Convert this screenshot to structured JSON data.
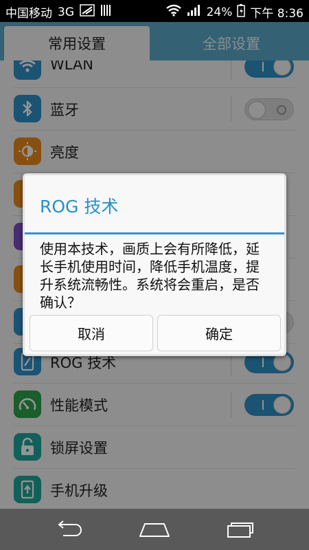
{
  "status_bar": {
    "carrier": "中国移动",
    "network": "3G",
    "battery": "24%",
    "time": "下午 8:36"
  },
  "tabs": [
    {
      "label": "常用设置",
      "selected": true
    },
    {
      "label": "全部设置",
      "selected": false
    }
  ],
  "settings": [
    {
      "label": "WLAN",
      "icon": "wifi-icon",
      "color": "#2f8fc6",
      "toggle": true,
      "on": true
    },
    {
      "label": "蓝牙",
      "icon": "bluetooth-icon",
      "color": "#2f8fc6",
      "toggle": true,
      "on": false
    },
    {
      "label": "亮度",
      "icon": "brightness-icon",
      "color": "#e98a1c",
      "toggle": false
    },
    {
      "label": "",
      "icon": "hidden-item-icon",
      "color": "#e98a1c",
      "toggle": false
    },
    {
      "label": "",
      "icon": "hidden-item-icon",
      "color": "#7c4fbf",
      "toggle": false
    },
    {
      "label": "",
      "icon": "hidden-item-icon",
      "color": "#e98a1c",
      "toggle": false
    },
    {
      "label": "",
      "icon": "hidden-item-icon",
      "color": "#2f8fc6",
      "toggle": true,
      "on": false
    },
    {
      "label": "ROG 技术",
      "icon": "rog-phone-icon",
      "color": "#2f8fc6",
      "toggle": true,
      "on": true
    },
    {
      "label": "性能模式",
      "icon": "speedometer-icon",
      "color": "#2ea24a",
      "toggle": true,
      "on": true
    },
    {
      "label": "锁屏设置",
      "icon": "unlock-icon",
      "color": "#1ea69a",
      "toggle": false
    },
    {
      "label": "手机升级",
      "icon": "phone-upgrade-icon",
      "color": "#1ea69a",
      "toggle": false
    }
  ],
  "dialog": {
    "title": "ROG 技术",
    "message": "使用本技术，画质上会有所降低，延长手机使用时间，降低手机温度，提升系统流畅性。系统将会重启，是否确认？",
    "cancel_label": "取消",
    "confirm_label": "确定"
  },
  "nav_bar": {
    "icons": [
      "back-icon",
      "home-icon",
      "recent-apps-icon"
    ]
  },
  "colors": {
    "accent": "#2f95cd",
    "tab_bar": "#5aa9c8",
    "nav_bar": "#595959"
  }
}
